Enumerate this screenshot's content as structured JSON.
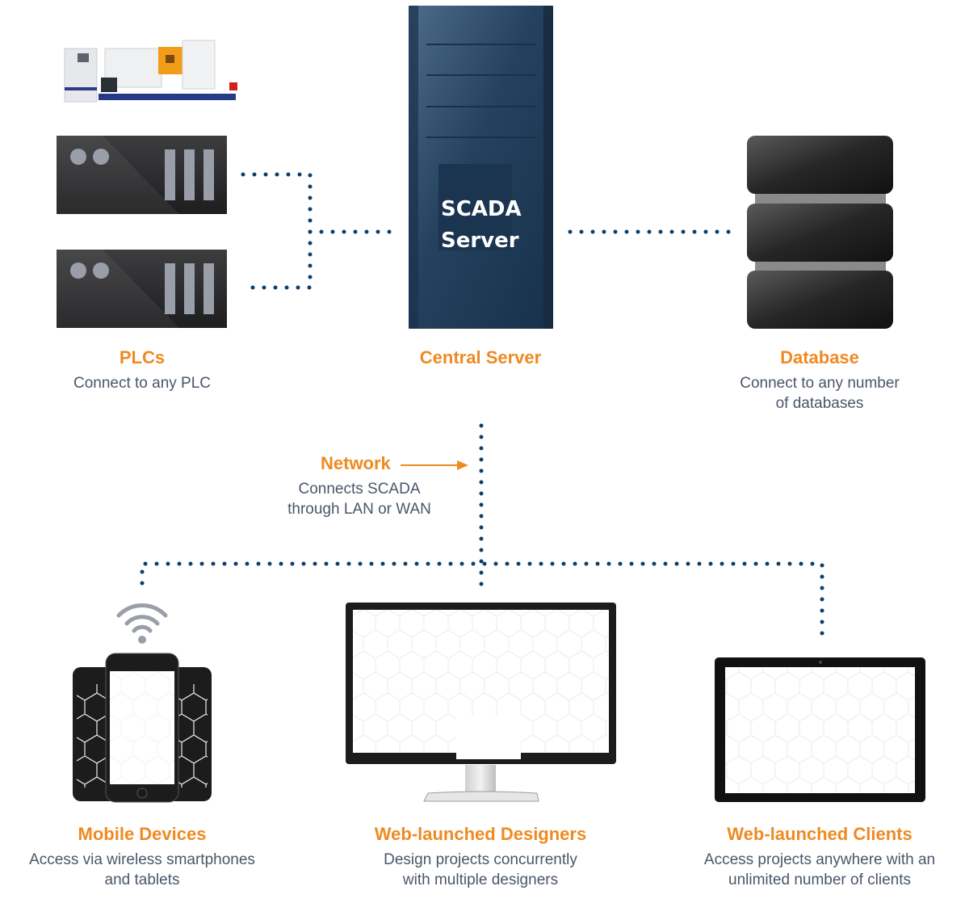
{
  "colors": {
    "accent": "#ef8a22",
    "text": "#4a5768",
    "connector": "#0b3f6b",
    "server": "#1f3a55",
    "device_dark": "#1c1c1c",
    "device_gray": "#9a9ea8"
  },
  "nodes": {
    "plcs": {
      "title": "PLCs",
      "desc": [
        "Connect to any PLC"
      ],
      "icon": "plc-rack-icon",
      "machine_icon": "industrial-machine-icon"
    },
    "server": {
      "title": "Central Server",
      "label": [
        "SCADA",
        "Server"
      ],
      "icon": "server-tower-icon"
    },
    "database": {
      "title": "Database",
      "desc": [
        "Connect to any number",
        "of databases"
      ],
      "icon": "database-icon"
    },
    "network": {
      "title": "Network",
      "desc": [
        "Connects SCADA",
        "through LAN or WAN"
      ],
      "icon": "arrow-right-icon"
    },
    "mobile": {
      "title": "Mobile Devices",
      "desc": [
        "Access via wireless smartphones",
        "and tablets"
      ],
      "icon": "smartphones-icon",
      "wifi_icon": "wifi-icon"
    },
    "designers": {
      "title": "Web-launched Designers",
      "desc": [
        "Design projects concurrently",
        "with multiple designers"
      ],
      "icon": "desktop-monitor-icon"
    },
    "clients": {
      "title": "Web-launched Clients",
      "desc": [
        "Access projects anywhere with an",
        "unlimited number of clients"
      ],
      "icon": "tablet-icon"
    }
  }
}
